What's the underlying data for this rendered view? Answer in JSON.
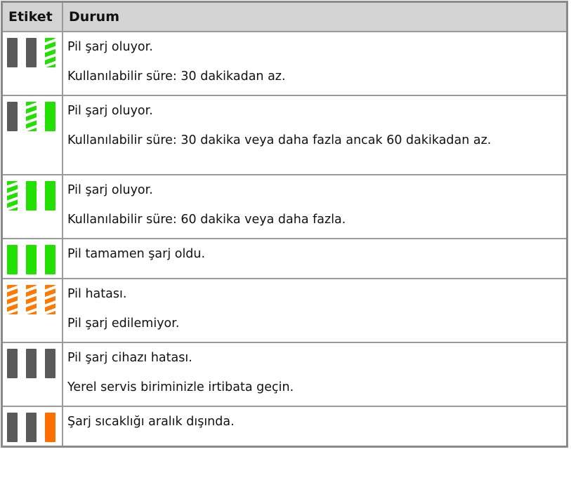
{
  "header": {
    "label_col": "Etiket",
    "status_col": "Durum"
  },
  "rows": [
    {
      "icon": [
        "gray",
        "gray",
        "green-stripe"
      ],
      "lines": [
        "Pil şarj oluyor.",
        "Kullanılabilir süre: 30 dakikadan az."
      ]
    },
    {
      "icon": [
        "gray",
        "green-stripe",
        "green"
      ],
      "lines": [
        "Pil şarj oluyor.",
        "Kullanılabilir süre: 30 dakika veya daha fazla ancak 60 dakikadan az."
      ]
    },
    {
      "icon": [
        "green-stripe",
        "green",
        "green"
      ],
      "lines": [
        "Pil şarj oluyor.",
        "Kullanılabilir süre: 60 dakika veya daha fazla."
      ]
    },
    {
      "icon": [
        "green",
        "green",
        "green"
      ],
      "lines": [
        "Pil tamamen şarj oldu."
      ]
    },
    {
      "icon": [
        "orange-stripe",
        "orange-stripe",
        "orange-stripe"
      ],
      "lines": [
        "Pil hatası.",
        "Pil şarj edilemiyor."
      ]
    },
    {
      "icon": [
        "gray",
        "gray",
        "gray"
      ],
      "lines": [
        "Pil şarj cihazı hatası.",
        "Yerel servis biriminizle irtibata geçin."
      ]
    },
    {
      "icon": [
        "gray",
        "gray",
        "orange"
      ],
      "lines": [
        "Şarj sıcaklığı aralık dışında."
      ]
    }
  ],
  "colors": {
    "gray": "#5a5a5a",
    "green": "#22e000",
    "orange": "#ff6f00",
    "header_bg": "#d4d4d4"
  }
}
